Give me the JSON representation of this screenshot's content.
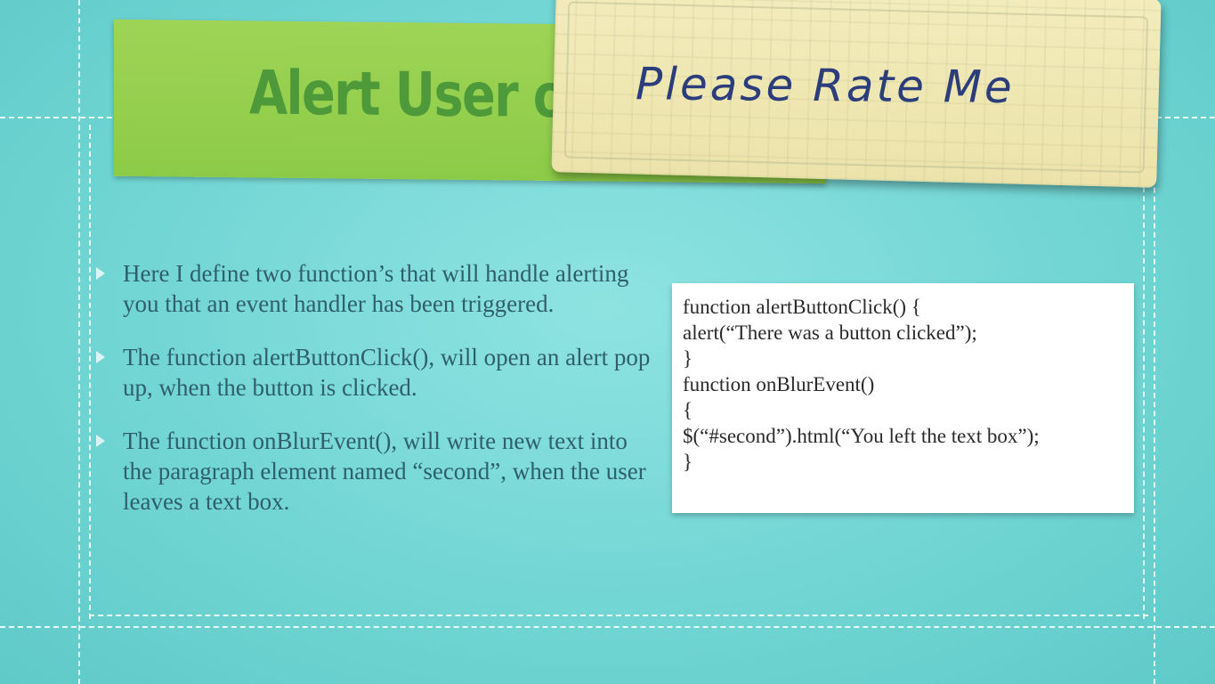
{
  "slide": {
    "title": "Alert User of",
    "rate_card_text": "Please Rate Me",
    "bullets": [
      "Here I define two function’s that will handle alerting you that an event handler has been triggered.",
      "The function alertButtonClick(), will open an alert pop up, when the button is clicked.",
      "The function onBlurEvent(), will write new text into the paragraph element named “second”, when the user leaves a text box."
    ],
    "code_lines": [
      "function alertButtonClick() {",
      "alert(“There was a button clicked”);",
      "}",
      "function onBlurEvent()",
      "{",
      "$(“#second”).html(“You left the text box”);",
      "}"
    ]
  },
  "colors": {
    "background": "#72d6d4",
    "banner": "#8ccb47",
    "title_text": "#4e9a3b",
    "card": "#ece3ab",
    "card_text": "#2b3d7a",
    "body_text": "#2f5f6b"
  }
}
